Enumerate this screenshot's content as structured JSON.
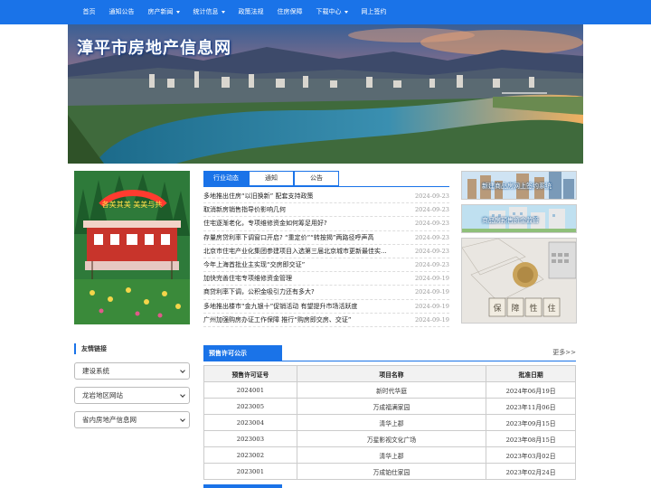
{
  "nav": {
    "items": [
      {
        "label": "首页",
        "has_caret": false
      },
      {
        "label": "通知公告",
        "has_caret": false
      },
      {
        "label": "房产新闻",
        "has_caret": true
      },
      {
        "label": "统计信息",
        "has_caret": true
      },
      {
        "label": "政策法规",
        "has_caret": false
      },
      {
        "label": "住房保障",
        "has_caret": false
      },
      {
        "label": "下载中心",
        "has_caret": true
      },
      {
        "label": "网上签约",
        "has_caret": false
      }
    ]
  },
  "banner": {
    "title": "漳平市房地产信息网"
  },
  "promo": {
    "text": "各美其美 美美与共"
  },
  "tabs": {
    "items": [
      "行业动态",
      "通知",
      "公告"
    ],
    "active": 0
  },
  "news": [
    {
      "title": "多地推出住房“以旧换新” 配套支持政策",
      "date": "2024-09-23"
    },
    {
      "title": "取消新房销售指导价影响几何",
      "date": "2024-09-23"
    },
    {
      "title": "住宅逐渐老化，专项维修资金如何筹足用好?",
      "date": "2024-09-23"
    },
    {
      "title": "存量房贷利率下调窗口开启? “重定价”“转按揭”两路径呼声高",
      "date": "2024-09-23"
    },
    {
      "title": "北京市住宅产业化集团参建项目入选第三届北京城市更新最佳实...",
      "date": "2024-09-23"
    },
    {
      "title": "今年上海首批业主实现“交房即交证”",
      "date": "2024-09-23"
    },
    {
      "title": "加快完善住宅专项维修资金管理",
      "date": "2024-09-19"
    },
    {
      "title": "商贷利率下调，公积金吸引力还有多大?",
      "date": "2024-09-19"
    },
    {
      "title": "多地推出楼市“金九银十”促销活动 有望提升市场活跃度",
      "date": "2024-09-19"
    },
    {
      "title": "广州加强购房办证工作保障 推行“购房即交房、交证”",
      "date": "2024-09-19"
    }
  ],
  "right_banners": {
    "b1": "新建商品房网上签约系统",
    "b2": "商品房预售资金监管",
    "b3": "保障性住房"
  },
  "friends": {
    "heading": "友情链接",
    "selects": [
      "建设系统",
      "龙岩地区网站",
      "省内房地产信息网"
    ]
  },
  "presale": {
    "tab": "预售许可公示",
    "more": "更多>>",
    "columns": [
      "预售许可证号",
      "项目名称",
      "批准日期"
    ],
    "rows": [
      [
        "2024001",
        "新时代华庭",
        "2024年06月19日"
      ],
      [
        "2023005",
        "万成福满家园",
        "2023年11月06日"
      ],
      [
        "2023004",
        "清华上郡",
        "2023年09月15日"
      ],
      [
        "2023003",
        "万星影视文化广场",
        "2023年08月15日"
      ],
      [
        "2023002",
        "清华上郡",
        "2023年03月02日"
      ],
      [
        "2023001",
        "万成铂仕家园",
        "2023年02月24日"
      ]
    ]
  },
  "colors": {
    "primary": "#1a73e8",
    "page_bg": "#ffffff"
  }
}
